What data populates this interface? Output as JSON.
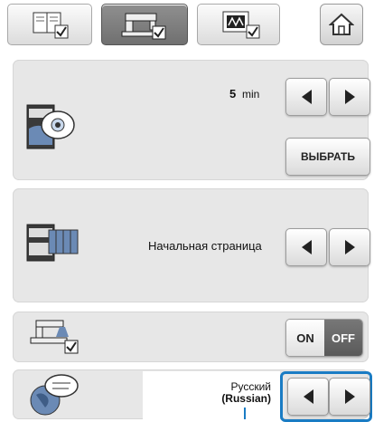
{
  "tabs": [
    {
      "name": "general-settings-tab",
      "icon": "book-check-icon"
    },
    {
      "name": "machine-settings-tab",
      "icon": "sewing-machine-check-icon"
    },
    {
      "name": "embroidery-settings-tab",
      "icon": "monitor-check-icon"
    }
  ],
  "home": {
    "icon": "home-icon"
  },
  "screensaver": {
    "time_value": "5",
    "time_unit": "min",
    "select_label": "ВЫБРАТЬ",
    "icon": "screensaver-icon"
  },
  "startup": {
    "value": "Начальная страница",
    "icon": "startup-screen-icon"
  },
  "toggle": {
    "on_label": "ON",
    "off_label": "OFF",
    "icon": "machine-light-icon"
  },
  "language": {
    "value_line1": "Русский",
    "value_line2": "(Russian)",
    "icon": "globe-language-icon"
  },
  "colors": {
    "accent": "#1a7cc4",
    "panel": "#e7e7e7",
    "off": "#5a5a5a"
  }
}
